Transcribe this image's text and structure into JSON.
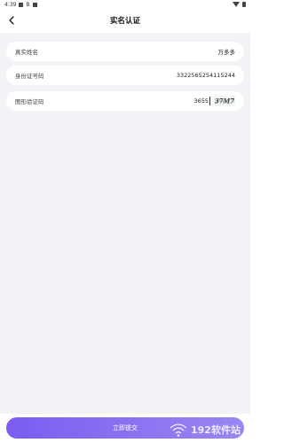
{
  "status_bar": {
    "time": "4:39",
    "indicator": "B"
  },
  "nav": {
    "title": "实名认证",
    "back_icon": "chevron-left-icon"
  },
  "form": {
    "name": {
      "label": "真实姓名",
      "value": "万多多"
    },
    "id_number": {
      "label": "身份证号码",
      "value": "3322565254115244"
    },
    "captcha": {
      "label": "图形验证码",
      "value": "3655",
      "image_text": "37M7"
    }
  },
  "submit": {
    "label": "立即提交"
  },
  "watermark": {
    "text": "192软件站"
  },
  "colors": {
    "accent": "#7b5cf0",
    "background": "#f2f2f7"
  }
}
